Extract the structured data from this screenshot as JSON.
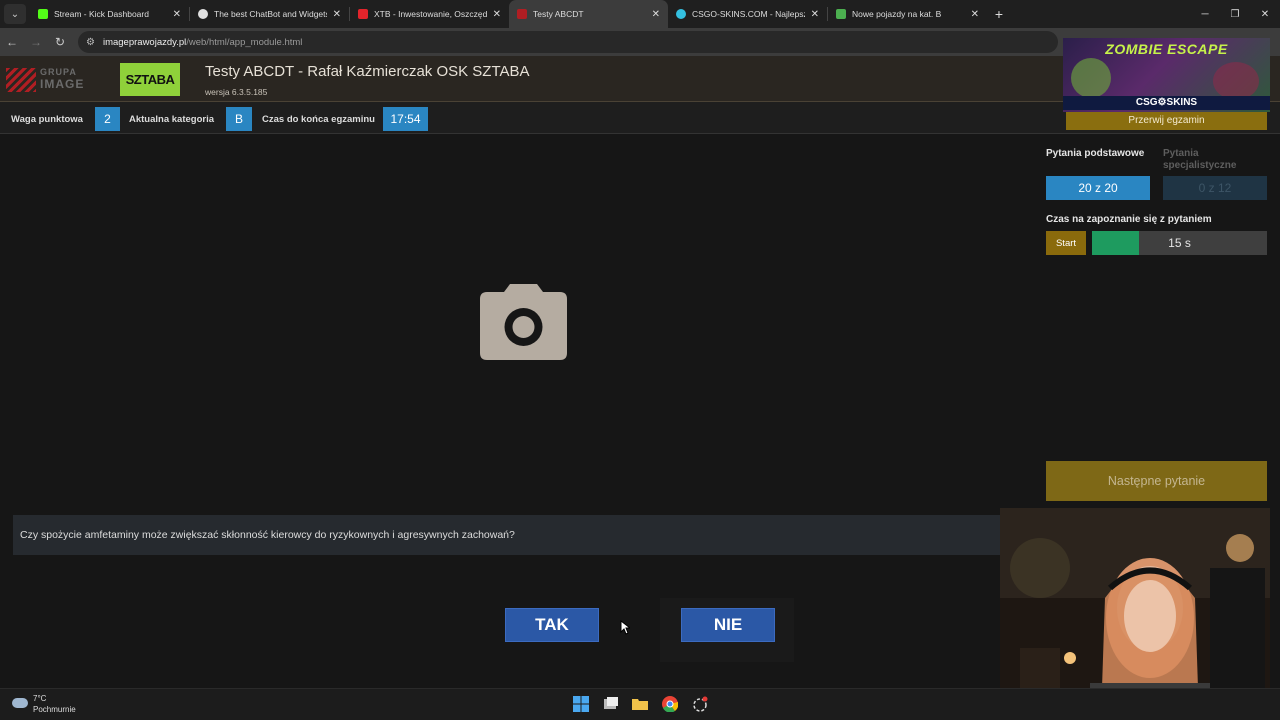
{
  "browser": {
    "tabs": [
      {
        "title": "Stream - Kick Dashboard",
        "favicon_color": "#53fc18",
        "active": false
      },
      {
        "title": "The best ChatBot and Widgets",
        "favicon_color": "#e0e0e0",
        "active": false
      },
      {
        "title": "XTB - Inwestowanie, Oszczędno",
        "favicon_color": "#e3242b",
        "active": false
      },
      {
        "title": "Testy ABCDT",
        "favicon_color": "#b01e23",
        "active": true
      },
      {
        "title": "CSGO-SKINS.COM - Najlepsze",
        "favicon_color": "#34c0e0",
        "active": false
      },
      {
        "title": "Nowe pojazdy na kat. B",
        "favicon_color": "#4caf50",
        "active": false
      }
    ],
    "address": {
      "host": "imageprawojazdy.pl",
      "path": "/web/html/app_module.html"
    }
  },
  "header": {
    "logo_text_line1": "GRUPA",
    "logo_text_line2": "IMAGE",
    "sztaba_logo": "SZTABA",
    "title": "Testy ABCDT - Rafał Kaźmierczak OSK SZTABA",
    "version": "wersja 6.3.5.185"
  },
  "status": {
    "weight_label": "Waga punktowa",
    "weight_value": "2",
    "category_label": "Aktualna kategoria",
    "category_value": "B",
    "time_label": "Czas do końca egzaminu",
    "time_value": "17:54"
  },
  "ad": {
    "title": "ZOMBIE ESCAPE",
    "brand": "CSG⚙SKINS"
  },
  "right_panel": {
    "interrupt_label": "Przerwij egzamin",
    "basic_label": "Pytania podstawowe",
    "special_label": "Pytania specjalistyczne",
    "basic_count": "20 z 20",
    "special_count": "0 z 12",
    "reading_time_label": "Czas na zapoznanie się z pytaniem",
    "start_label": "Start",
    "timer_value": "15 s",
    "timer_progress": 0.27,
    "next_label": "Następne pytanie"
  },
  "question": {
    "text": "Czy spożycie amfetaminy może zwiększać skłonność kierowcy do ryzykownych i agresywnych zachowań?",
    "yes_label": "TAK",
    "no_label": "NIE"
  },
  "taskbar": {
    "temperature": "7°C",
    "weather": "Pochmurnie"
  },
  "colors": {
    "accent_blue": "#2a86c2",
    "answer_blue": "#2b58a6",
    "gold": "#8a6e0f",
    "timer_green": "#1e9b5f"
  }
}
